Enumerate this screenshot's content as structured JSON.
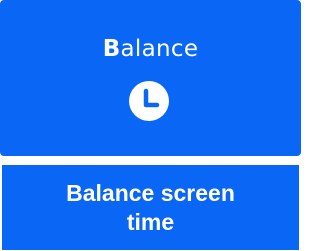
{
  "tile": {
    "title_first_letter": "B",
    "title_rest": "alance",
    "icon": "clock-icon"
  },
  "caption": {
    "text": "Balance screen time"
  },
  "colors": {
    "tile_background": "#0a66f4",
    "text": "#ffffff"
  }
}
